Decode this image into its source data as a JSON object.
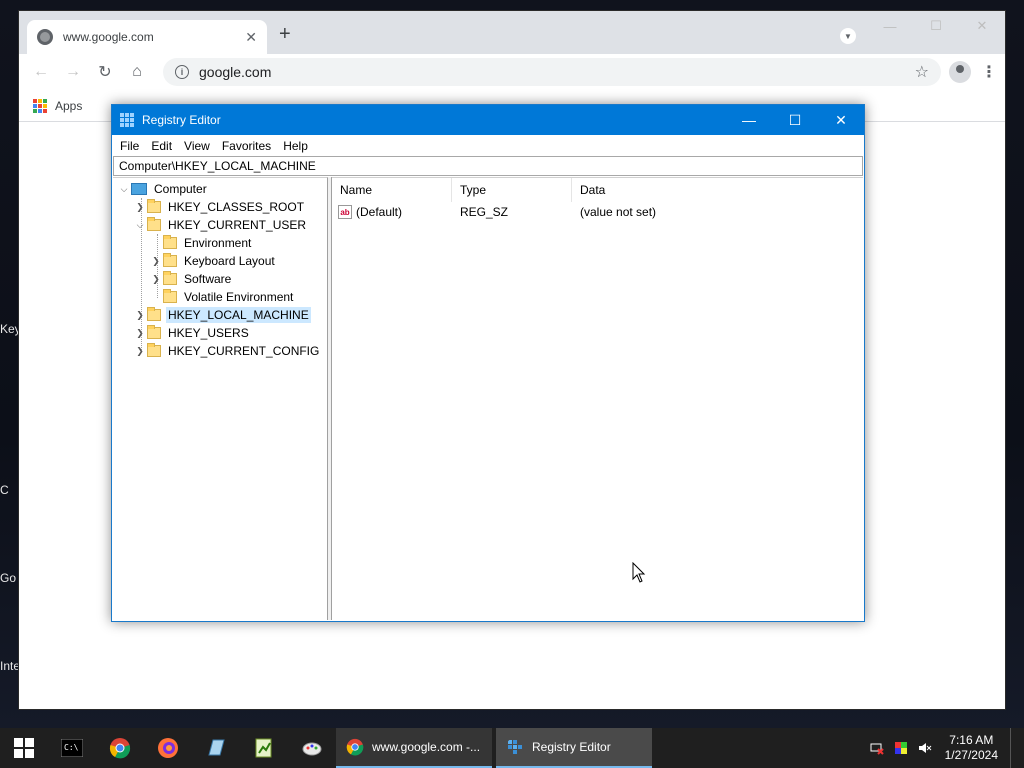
{
  "desktop": {
    "labels": [
      "Key",
      "C",
      "Go",
      "Inte"
    ]
  },
  "chrome": {
    "tab_title": "www.google.com",
    "tab_close": "✕",
    "new_tab": "+",
    "url": "google.com",
    "bookmarks": {
      "apps_label": "Apps"
    },
    "icons": [
      "back-arrow-icon",
      "forward-arrow-icon",
      "reload-icon",
      "home-icon",
      "info-icon",
      "star-icon",
      "profile-icon",
      "menu-icon"
    ]
  },
  "regedit": {
    "title": "Registry Editor",
    "menu": [
      "File",
      "Edit",
      "View",
      "Favorites",
      "Help"
    ],
    "address": "Computer\\HKEY_LOCAL_MACHINE",
    "tree": {
      "root": "Computer",
      "hives": [
        "HKEY_CLASSES_ROOT",
        "HKEY_CURRENT_USER",
        "HKEY_LOCAL_MACHINE",
        "HKEY_USERS",
        "HKEY_CURRENT_CONFIG"
      ],
      "current_user_children": [
        "Environment",
        "Keyboard Layout",
        "Software",
        "Volatile Environment"
      ],
      "selected": "HKEY_LOCAL_MACHINE"
    },
    "columns": [
      "Name",
      "Type",
      "Data"
    ],
    "values": [
      {
        "name": "(Default)",
        "type": "REG_SZ",
        "data": "(value not set)"
      }
    ]
  },
  "taskbar": {
    "tasks": [
      {
        "label": "www.google.com -...",
        "state": "inactive"
      },
      {
        "label": "Registry Editor",
        "state": "active"
      }
    ],
    "clock": {
      "time": "7:16 AM",
      "date": "1/27/2024"
    }
  },
  "colors": {
    "regedit_title": "#0078d7",
    "selection": "#cce8ff",
    "taskbar": "#1f1f1f",
    "chrome_tabbar": "#dee1e6"
  }
}
